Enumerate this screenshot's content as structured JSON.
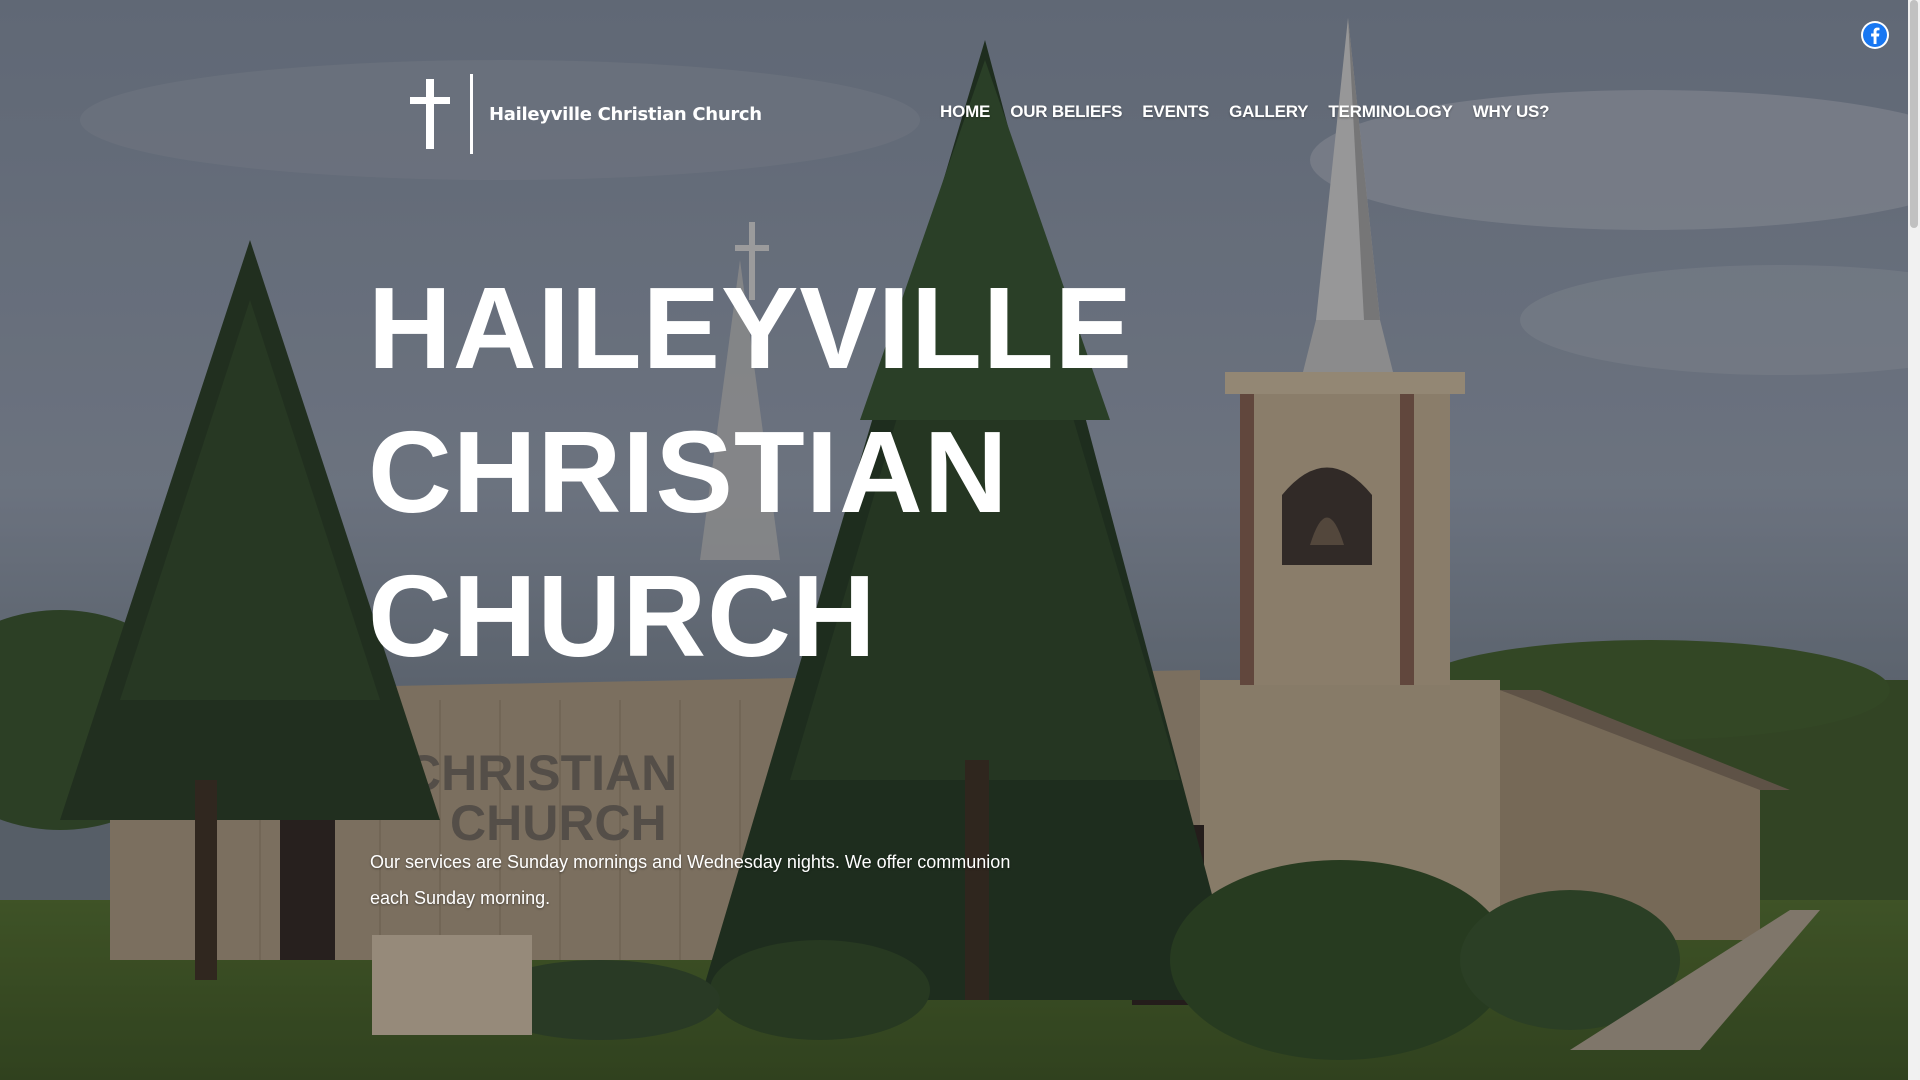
{
  "site": {
    "name": "Haileyville Christian Church"
  },
  "social": {
    "facebook_icon": "facebook-icon"
  },
  "nav": {
    "items": [
      {
        "label": "HOME"
      },
      {
        "label": "OUR BELIEFS"
      },
      {
        "label": "EVENTS"
      },
      {
        "label": "GALLERY"
      },
      {
        "label": "TERMINOLOGY"
      },
      {
        "label": "WHY US?"
      }
    ]
  },
  "hero": {
    "title_lines": [
      "HAILEYVILLE",
      "CHRISTIAN",
      "CHURCH"
    ],
    "description": "Our services are Sunday mornings and Wednesday nights. We offer communion each Sunday morning.",
    "sign_line1": "CHRISTIAN",
    "sign_line2": "CHURCH"
  },
  "colors": {
    "text": "#ffffff",
    "facebook_blue": "#1877f2",
    "sky": "#8a94a4",
    "building": "#b9a78a"
  }
}
